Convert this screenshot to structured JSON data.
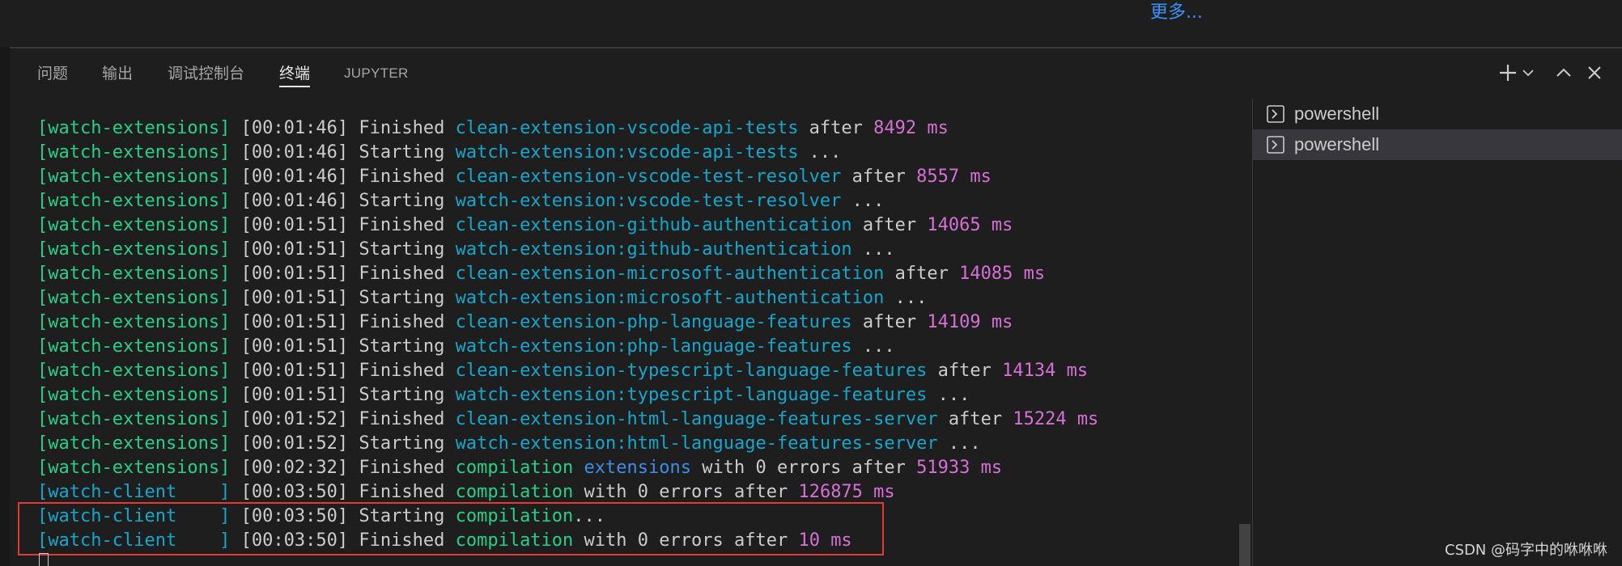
{
  "header": {
    "more_link": "更多..."
  },
  "tabs": [
    {
      "label": "问题"
    },
    {
      "label": "输出"
    },
    {
      "label": "调试控制台"
    },
    {
      "label": "终端",
      "active": true
    },
    {
      "label": "JUPYTER"
    }
  ],
  "toolbar_icons": [
    "plus-icon",
    "chevron-down-icon",
    "chevron-up-icon",
    "close-icon"
  ],
  "colors": {
    "green": "#23d18b",
    "cyan": "#11a8cd",
    "blue": "#3b8eea",
    "magenta": "#d670d6",
    "text": "#cccccc",
    "highlight_border": "#e53935",
    "link": "#3794ff"
  },
  "terminal_lines": [
    [
      [
        "[watch-extensions]",
        "g"
      ],
      [
        " [",
        "w"
      ],
      [
        "00:01:46",
        "w"
      ],
      [
        "] Finished ",
        "w"
      ],
      [
        "clean-extension-vscode-api-tests",
        "c"
      ],
      [
        " after ",
        "w"
      ],
      [
        "8492 ms",
        "m"
      ]
    ],
    [
      [
        "[watch-extensions]",
        "g"
      ],
      [
        " [",
        "w"
      ],
      [
        "00:01:46",
        "w"
      ],
      [
        "] Starting ",
        "w"
      ],
      [
        "watch-extension:vscode-api-tests",
        "c"
      ],
      [
        " ...",
        "w"
      ]
    ],
    [
      [
        "[watch-extensions]",
        "g"
      ],
      [
        " [",
        "w"
      ],
      [
        "00:01:46",
        "w"
      ],
      [
        "] Finished ",
        "w"
      ],
      [
        "clean-extension-vscode-test-resolver",
        "c"
      ],
      [
        " after ",
        "w"
      ],
      [
        "8557 ms",
        "m"
      ]
    ],
    [
      [
        "[watch-extensions]",
        "g"
      ],
      [
        " [",
        "w"
      ],
      [
        "00:01:46",
        "w"
      ],
      [
        "] Starting ",
        "w"
      ],
      [
        "watch-extension:vscode-test-resolver",
        "c"
      ],
      [
        " ...",
        "w"
      ]
    ],
    [
      [
        "[watch-extensions]",
        "g"
      ],
      [
        " [",
        "w"
      ],
      [
        "00:01:51",
        "w"
      ],
      [
        "] Finished ",
        "w"
      ],
      [
        "clean-extension-github-authentication",
        "c"
      ],
      [
        " after ",
        "w"
      ],
      [
        "14065 ms",
        "m"
      ]
    ],
    [
      [
        "[watch-extensions]",
        "g"
      ],
      [
        " [",
        "w"
      ],
      [
        "00:01:51",
        "w"
      ],
      [
        "] Starting ",
        "w"
      ],
      [
        "watch-extension:github-authentication",
        "c"
      ],
      [
        " ...",
        "w"
      ]
    ],
    [
      [
        "[watch-extensions]",
        "g"
      ],
      [
        " [",
        "w"
      ],
      [
        "00:01:51",
        "w"
      ],
      [
        "] Finished ",
        "w"
      ],
      [
        "clean-extension-microsoft-authentication",
        "c"
      ],
      [
        " after ",
        "w"
      ],
      [
        "14085 ms",
        "m"
      ]
    ],
    [
      [
        "[watch-extensions]",
        "g"
      ],
      [
        " [",
        "w"
      ],
      [
        "00:01:51",
        "w"
      ],
      [
        "] Starting ",
        "w"
      ],
      [
        "watch-extension:microsoft-authentication",
        "c"
      ],
      [
        " ...",
        "w"
      ]
    ],
    [
      [
        "[watch-extensions]",
        "g"
      ],
      [
        " [",
        "w"
      ],
      [
        "00:01:51",
        "w"
      ],
      [
        "] Finished ",
        "w"
      ],
      [
        "clean-extension-php-language-features",
        "c"
      ],
      [
        " after ",
        "w"
      ],
      [
        "14109 ms",
        "m"
      ]
    ],
    [
      [
        "[watch-extensions]",
        "g"
      ],
      [
        " [",
        "w"
      ],
      [
        "00:01:51",
        "w"
      ],
      [
        "] Starting ",
        "w"
      ],
      [
        "watch-extension:php-language-features",
        "c"
      ],
      [
        " ...",
        "w"
      ]
    ],
    [
      [
        "[watch-extensions]",
        "g"
      ],
      [
        " [",
        "w"
      ],
      [
        "00:01:51",
        "w"
      ],
      [
        "] Finished ",
        "w"
      ],
      [
        "clean-extension-typescript-language-features",
        "c"
      ],
      [
        " after ",
        "w"
      ],
      [
        "14134 ms",
        "m"
      ]
    ],
    [
      [
        "[watch-extensions]",
        "g"
      ],
      [
        " [",
        "w"
      ],
      [
        "00:01:51",
        "w"
      ],
      [
        "] Starting ",
        "w"
      ],
      [
        "watch-extension:typescript-language-features",
        "c"
      ],
      [
        " ...",
        "w"
      ]
    ],
    [
      [
        "[watch-extensions]",
        "g"
      ],
      [
        " [",
        "w"
      ],
      [
        "00:01:52",
        "w"
      ],
      [
        "] Finished ",
        "w"
      ],
      [
        "clean-extension-html-language-features-server",
        "c"
      ],
      [
        " after ",
        "w"
      ],
      [
        "15224 ms",
        "m"
      ]
    ],
    [
      [
        "[watch-extensions]",
        "g"
      ],
      [
        " [",
        "w"
      ],
      [
        "00:01:52",
        "w"
      ],
      [
        "] Starting ",
        "w"
      ],
      [
        "watch-extension:html-language-features-server",
        "c"
      ],
      [
        " ...",
        "w"
      ]
    ],
    [
      [
        "[watch-extensions]",
        "g"
      ],
      [
        " [",
        "w"
      ],
      [
        "00:02:32",
        "w"
      ],
      [
        "] Finished ",
        "w"
      ],
      [
        "compilation",
        "g"
      ],
      [
        " ",
        "w"
      ],
      [
        "extensions",
        "b"
      ],
      [
        " with 0 errors after ",
        "w"
      ],
      [
        "51933 ms",
        "m"
      ]
    ],
    [
      [
        "[watch-client    ]",
        "c"
      ],
      [
        " [",
        "w"
      ],
      [
        "00:03:50",
        "w"
      ],
      [
        "] Finished ",
        "w"
      ],
      [
        "compilation",
        "g"
      ],
      [
        " with 0 errors after ",
        "w"
      ],
      [
        "126875 ms",
        "m"
      ]
    ],
    [
      [
        "[watch-client    ]",
        "c"
      ],
      [
        " [",
        "w"
      ],
      [
        "00:03:50",
        "w"
      ],
      [
        "] Starting ",
        "w"
      ],
      [
        "compilation",
        "g"
      ],
      [
        "...",
        "w"
      ]
    ],
    [
      [
        "[watch-client    ]",
        "c"
      ],
      [
        " [",
        "w"
      ],
      [
        "00:03:50",
        "w"
      ],
      [
        "] Finished ",
        "w"
      ],
      [
        "compilation",
        "g"
      ],
      [
        " with 0 errors after ",
        "w"
      ],
      [
        "10 ms",
        "m"
      ]
    ]
  ],
  "terminal_tabs": [
    {
      "label": "powershell",
      "selected": false
    },
    {
      "label": "powershell",
      "selected": true
    }
  ],
  "watermark": "CSDN @码字中的咻咻咻"
}
